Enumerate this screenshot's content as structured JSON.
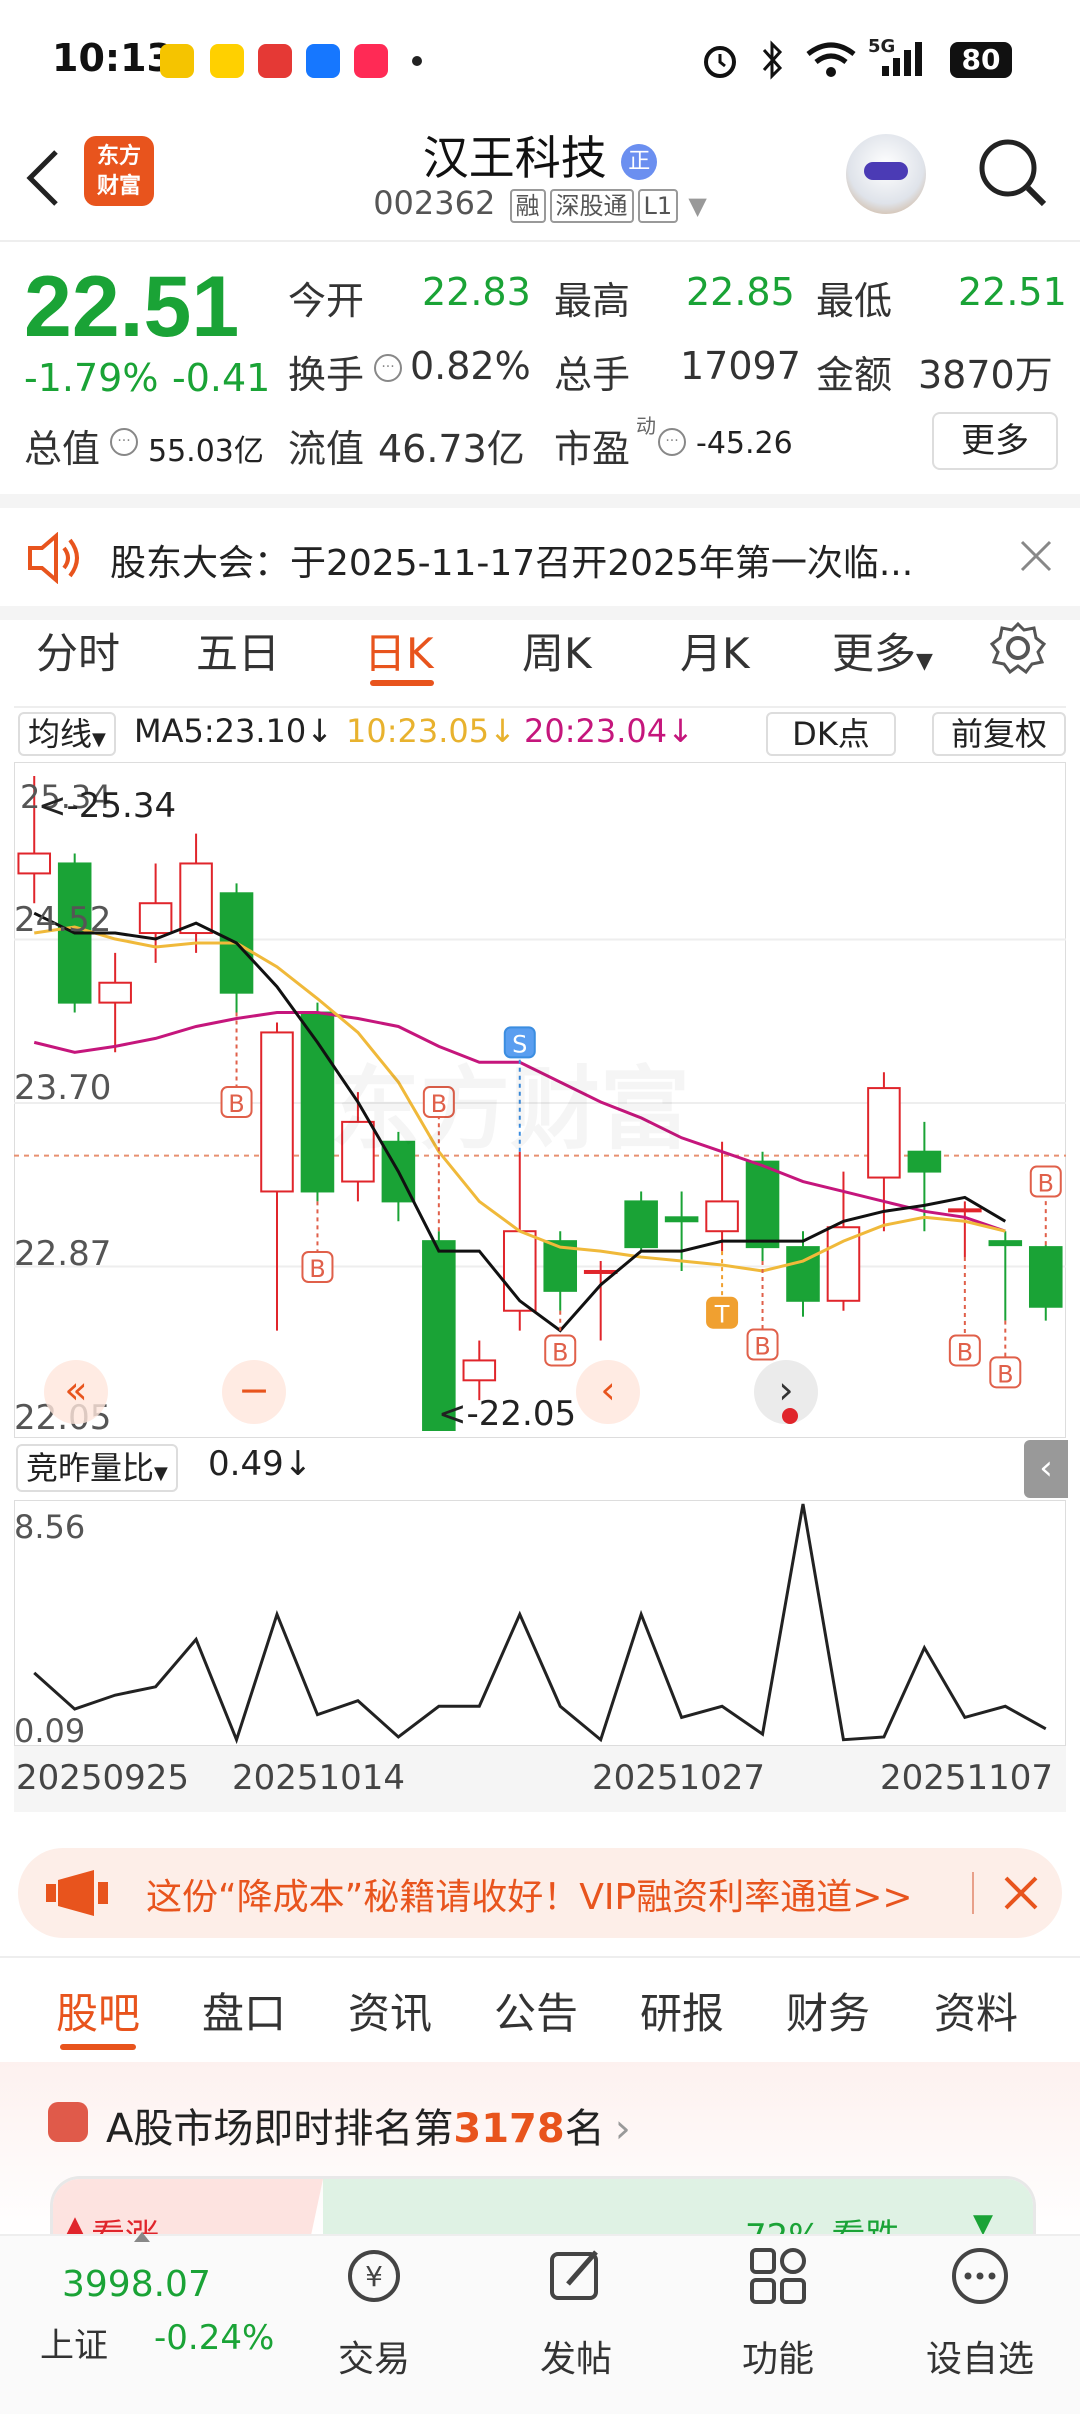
{
  "status_bar": {
    "time": "10:13",
    "network": "5G",
    "battery": "80"
  },
  "header": {
    "back_icon": "chevron-left-icon",
    "logo_line1": "东方",
    "logo_line2": "财富",
    "stock_name": "汉王科技",
    "stock_code": "002362",
    "tags": [
      "融",
      "深股通",
      "L1"
    ]
  },
  "quote": {
    "price": "22.51",
    "change_pct": "-1.79%",
    "change_amt": "-0.41",
    "rows": [
      [
        {
          "label": "今开",
          "value": "22.83"
        },
        {
          "label": "最高",
          "value": "22.85"
        },
        {
          "label": "最低",
          "value": "22.51"
        }
      ],
      [
        {
          "label": "换手",
          "value": "0.82%"
        },
        {
          "label": "总手",
          "value": "17097"
        },
        {
          "label": "金额",
          "value": "3870万"
        }
      ]
    ],
    "market_cap_label": "总值",
    "market_cap": "55.03亿",
    "float_label": "流值",
    "float_cap": "46.73亿",
    "pe_label": "市盈",
    "pe_sup": "动",
    "pe_value": "-45.26",
    "more_label": "更多"
  },
  "notice": {
    "text": "股东大会：于2025-11-17召开2025年第一次临..."
  },
  "chart_tabs": [
    "分时",
    "五日",
    "日K",
    "周K",
    "月K",
    "更多"
  ],
  "active_tab": "日K",
  "ma_bar": {
    "selector": "均线",
    "ma5": "MA5:23.10↓",
    "ma10": "10:23.05↓",
    "ma20": "20:23.04↓",
    "dk": "DK点",
    "adjust": "前复权"
  },
  "chart_data": {
    "type": "candlestick",
    "y_ticks": [
      "25.34",
      "24.52",
      "23.70",
      "22.87",
      "22.05"
    ],
    "ylim": [
      22.05,
      25.34
    ],
    "max_label": "<-25.34",
    "min_label": "<-22.05",
    "watermark": "东方财富",
    "candles": [
      {
        "o": 24.85,
        "c": 24.95,
        "h": 25.34,
        "l": 24.7
      },
      {
        "o": 24.9,
        "c": 24.2,
        "h": 24.95,
        "l": 24.15
      },
      {
        "o": 24.2,
        "c": 24.3,
        "h": 24.45,
        "l": 23.95
      },
      {
        "o": 24.55,
        "c": 24.7,
        "h": 24.9,
        "l": 24.4
      },
      {
        "o": 24.55,
        "c": 24.9,
        "h": 25.05,
        "l": 24.45
      },
      {
        "o": 24.75,
        "c": 24.25,
        "h": 24.8,
        "l": 24.15
      },
      {
        "o": 23.25,
        "c": 24.05,
        "h": 24.1,
        "l": 22.55
      },
      {
        "o": 24.15,
        "c": 23.25,
        "h": 24.2,
        "l": 23.2
      },
      {
        "o": 23.3,
        "c": 23.6,
        "h": 23.75,
        "l": 23.2
      },
      {
        "o": 23.5,
        "c": 23.2,
        "h": 23.55,
        "l": 23.1
      },
      {
        "o": 23.0,
        "c": 22.05,
        "h": 23.05,
        "l": 22.05
      },
      {
        "o": 22.3,
        "c": 22.4,
        "h": 22.5,
        "l": 22.2
      },
      {
        "o": 22.65,
        "c": 23.05,
        "h": 23.45,
        "l": 22.55
      },
      {
        "o": 23.0,
        "c": 22.75,
        "h": 23.05,
        "l": 22.65
      },
      {
        "o": 22.85,
        "c": 22.85,
        "h": 22.9,
        "l": 22.5
      },
      {
        "o": 23.2,
        "c": 22.97,
        "h": 23.25,
        "l": 22.95
      },
      {
        "o": 23.12,
        "c": 23.1,
        "h": 23.25,
        "l": 22.85
      },
      {
        "o": 23.05,
        "c": 23.2,
        "h": 23.5,
        "l": 22.95
      },
      {
        "o": 23.4,
        "c": 22.97,
        "h": 23.45,
        "l": 22.9
      },
      {
        "o": 22.97,
        "c": 22.7,
        "h": 23.05,
        "l": 22.62
      },
      {
        "o": 22.7,
        "c": 23.07,
        "h": 23.35,
        "l": 22.65
      },
      {
        "o": 23.32,
        "c": 23.77,
        "h": 23.85,
        "l": 23.05
      },
      {
        "o": 23.45,
        "c": 23.35,
        "h": 23.6,
        "l": 23.05
      },
      {
        "o": 23.15,
        "c": 23.16,
        "h": 23.2,
        "l": 22.92
      },
      {
        "o": 23.0,
        "c": 22.98,
        "h": 23.05,
        "l": 22.6
      },
      {
        "o": 22.97,
        "c": 22.67,
        "h": 22.98,
        "l": 22.6
      }
    ],
    "ma5": [
      24.65,
      24.55,
      24.55,
      24.52,
      24.6,
      24.5,
      24.28,
      24.0,
      23.7,
      23.35,
      22.95,
      22.95,
      22.7,
      22.55,
      22.78,
      22.95,
      22.95,
      23.0,
      23.0,
      23.0,
      23.1,
      23.15,
      23.18,
      23.22,
      23.1
    ],
    "ma10": [
      24.55,
      24.58,
      24.52,
      24.48,
      24.5,
      24.5,
      24.38,
      24.22,
      24.05,
      23.8,
      23.45,
      23.2,
      23.05,
      22.97,
      22.95,
      22.92,
      22.9,
      22.88,
      22.85,
      22.9,
      23.0,
      23.08,
      23.12,
      23.1,
      23.05
    ],
    "ma20": [
      24.0,
      23.95,
      23.98,
      24.02,
      24.08,
      24.12,
      24.15,
      24.15,
      24.12,
      24.08,
      23.98,
      23.9,
      23.9,
      23.8,
      23.7,
      23.62,
      23.52,
      23.45,
      23.38,
      23.3,
      23.25,
      23.2,
      23.15,
      23.12,
      23.05
    ],
    "markers": [
      {
        "i": 5,
        "label": "B",
        "below": true,
        "price": 23.7
      },
      {
        "i": 7,
        "label": "B",
        "below": true,
        "price": 22.87
      },
      {
        "i": 10,
        "label": "B",
        "below": false,
        "price": 23.7
      },
      {
        "i": 12,
        "label": "S",
        "below": false,
        "price": 24.0
      },
      {
        "i": 13,
        "label": "B",
        "below": true,
        "price": 22.45
      },
      {
        "i": 17,
        "label": "T",
        "below": true,
        "price": 22.64
      },
      {
        "i": 18,
        "label": "B",
        "below": true,
        "price": 22.48
      },
      {
        "i": 23,
        "label": "B",
        "below": true,
        "price": 22.45
      },
      {
        "i": 24,
        "label": "B",
        "below": true,
        "price": 22.34
      },
      {
        "i": 25,
        "label": "B",
        "below": false,
        "price": 23.3
      }
    ],
    "last_price_line": 23.43,
    "dates": [
      "20250925",
      "20251014",
      "20251027",
      "20251107"
    ]
  },
  "volume_chart": {
    "selector": "竞昨量比",
    "value": "0.49↓",
    "y_ticks": [
      "8.56",
      "0.09"
    ],
    "ylim": [
      0.09,
      8.56
    ],
    "values": [
      2.5,
      1.2,
      1.7,
      2.0,
      3.7,
      0.1,
      4.6,
      1.0,
      1.5,
      0.2,
      1.3,
      1.3,
      4.6,
      1.3,
      0.1,
      4.6,
      0.9,
      1.3,
      0.3,
      8.56,
      0.1,
      0.2,
      3.4,
      0.9,
      1.3,
      0.49
    ]
  },
  "promo": {
    "text": "这份“降成本”秘籍请收好！VIP融资利率通道>>"
  },
  "section_tabs": [
    "股吧",
    "盘口",
    "资讯",
    "公告",
    "研报",
    "财务",
    "资料"
  ],
  "ranking": {
    "prefix": "A股市场即时排名第",
    "rank": "3178",
    "suffix": "名"
  },
  "sentiment": {
    "up_label": "看涨",
    "down_label": "72% 看跌"
  },
  "bottom_nav": {
    "index_value": "3998.07",
    "index_name": "上证",
    "index_change": "-0.24%",
    "items": [
      "交易",
      "发帖",
      "功能",
      "设自选"
    ]
  }
}
